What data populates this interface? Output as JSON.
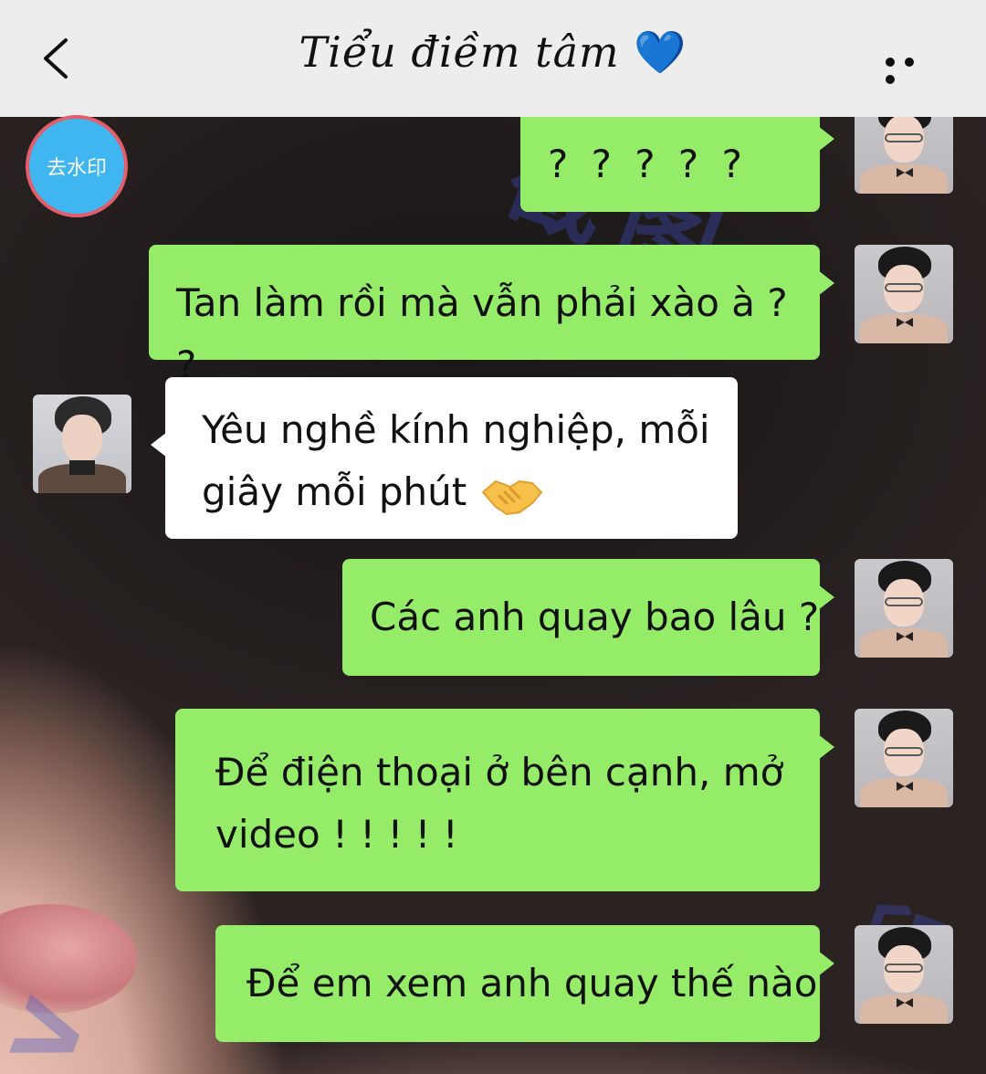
{
  "header": {
    "title": "Tiểu điềm tâm",
    "title_emoji": "💙"
  },
  "badge": {
    "label": "去水印"
  },
  "messages": [
    {
      "sender": "me",
      "text": "? ? ? ? ?"
    },
    {
      "sender": "me",
      "text": "Tan làm rồi mà vẫn phải xào à ? ?"
    },
    {
      "sender": "other",
      "text_line1": "Yêu nghề kính nghiệp, mỗi",
      "text_line2": "giây mỗi phút",
      "emoji": "handshake"
    },
    {
      "sender": "me",
      "text": "Các anh quay bao lâu ?"
    },
    {
      "sender": "me",
      "text_line1": "Để điện thoại ở bên cạnh, mở",
      "text_line2": "video ! ! ! ! !"
    },
    {
      "sender": "me",
      "text": "Để em xem anh quay thế nào"
    }
  ],
  "colors": {
    "my_bubble": "#95ec69",
    "other_bubble": "#ffffff",
    "header_bg": "#ededed",
    "badge_bg": "#3fb6ef",
    "badge_border": "#e35d6a"
  }
}
